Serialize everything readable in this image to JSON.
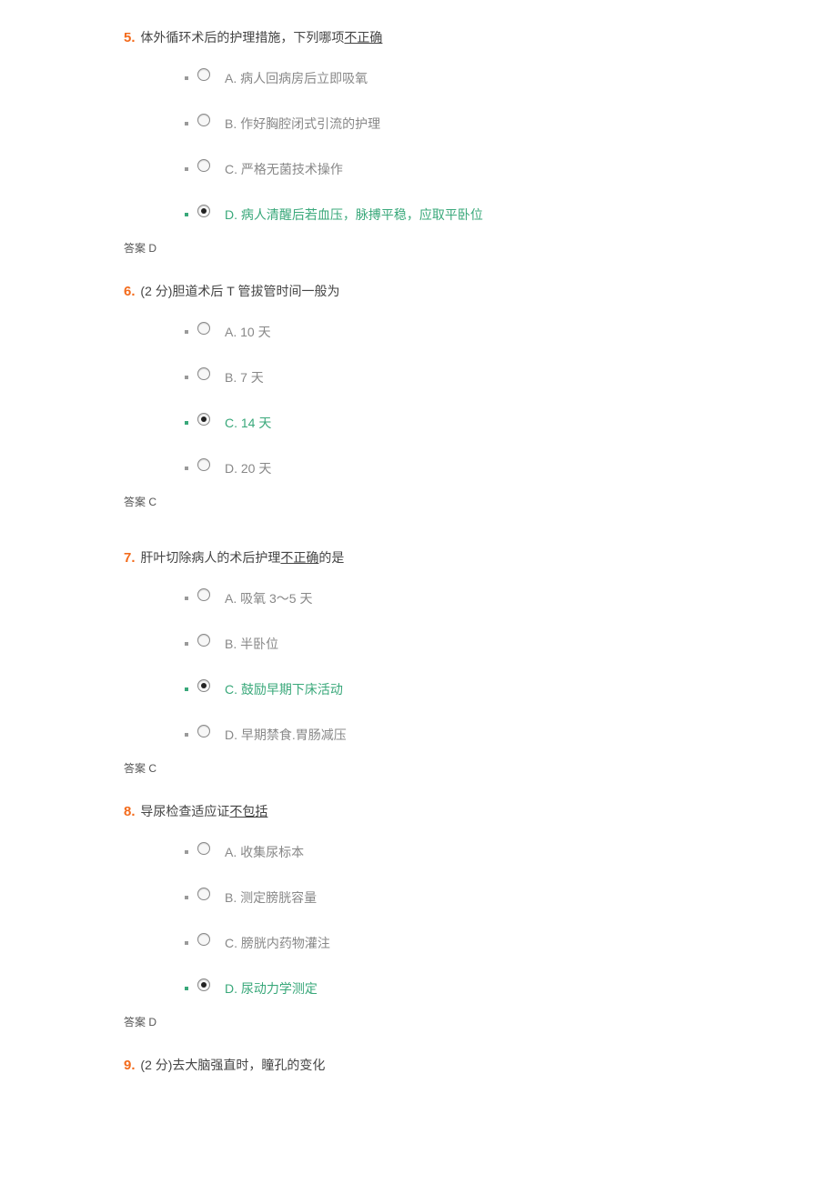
{
  "questions": [
    {
      "num": "5.",
      "stem_pre": "体外循环术后的护理措施，下列哪项",
      "stem_underline": "不正确",
      "stem_post": "",
      "answer_label": "答案  D",
      "answer_extra_class": "",
      "options": [
        {
          "text": "A.  病人回病房后立即吸氧",
          "checked": false,
          "correct": false
        },
        {
          "text": "B.  作好胸腔闭式引流的护理",
          "checked": false,
          "correct": false
        },
        {
          "text": "C.  严格无菌技术操作",
          "checked": false,
          "correct": false
        },
        {
          "text": "D.  病人清醒后若血压，脉搏平稳，应取平卧位",
          "checked": true,
          "correct": true
        }
      ]
    },
    {
      "num": "6.",
      "stem_pre": "(2 分)胆道术后 T 管拔管时间一般为",
      "stem_underline": "",
      "stem_post": "",
      "answer_label": "答案  C",
      "answer_extra_class": "spacer-after-6",
      "options": [
        {
          "text": "A. 10 天",
          "checked": false,
          "correct": false
        },
        {
          "text": "B. 7 天",
          "checked": false,
          "correct": false
        },
        {
          "text": "C. 14 天",
          "checked": true,
          "correct": true
        },
        {
          "text": "D. 20 天",
          "checked": false,
          "correct": false
        }
      ]
    },
    {
      "num": "7.",
      "stem_pre": "肝叶切除病人的术后护理",
      "stem_underline": "不正确",
      "stem_post": "的是",
      "answer_label": "答案  C",
      "answer_extra_class": "",
      "options": [
        {
          "text": "A.  吸氧 3～5 天",
          "checked": false,
          "correct": false
        },
        {
          "text": "B.  半卧位",
          "checked": false,
          "correct": false
        },
        {
          "text": "C.  鼓励早期下床活动",
          "checked": true,
          "correct": true
        },
        {
          "text": "D.  早期禁食.胃肠减压",
          "checked": false,
          "correct": false
        }
      ]
    },
    {
      "num": "8.",
      "stem_pre": "导尿检查适应证",
      "stem_underline": "不包括",
      "stem_post": "",
      "answer_label": "答案  D",
      "answer_extra_class": "",
      "options": [
        {
          "text": "A.  收集尿标本",
          "checked": false,
          "correct": false
        },
        {
          "text": "B.  测定膀胱容量",
          "checked": false,
          "correct": false
        },
        {
          "text": "C.  膀胱内药物灌注",
          "checked": false,
          "correct": false
        },
        {
          "text": "D.  尿动力学测定",
          "checked": true,
          "correct": true
        }
      ]
    },
    {
      "num": "9.",
      "stem_pre": "(2 分)去大脑强直时，瞳孔的变化",
      "stem_underline": "",
      "stem_post": "",
      "answer_label": "",
      "answer_extra_class": "",
      "options": []
    }
  ]
}
